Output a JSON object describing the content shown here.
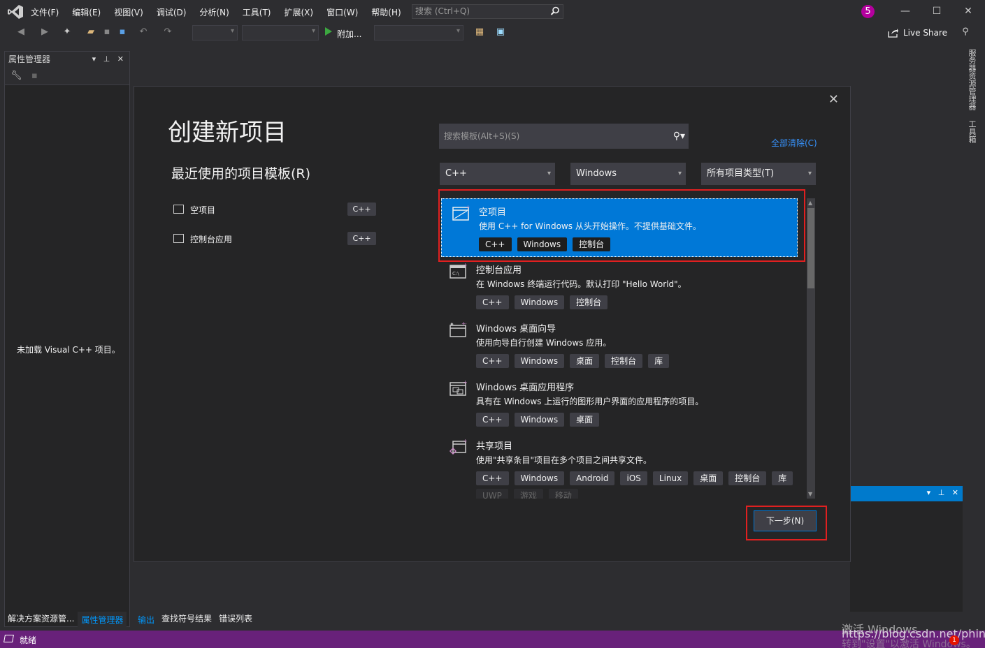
{
  "menu": [
    "文件(F)",
    "编辑(E)",
    "视图(V)",
    "调试(D)",
    "分析(N)",
    "工具(T)",
    "扩展(X)",
    "窗口(W)",
    "帮助(H)"
  ],
  "quick_search_placeholder": "搜索 (Ctrl+Q)",
  "notification_count": "5",
  "toolbar": {
    "run_label": "附加...",
    "live_share": "Live Share"
  },
  "left_panel": {
    "title": "属性管理器",
    "message": "未加载 Visual C++ 项目。",
    "tabs": [
      "解决方案资源管...",
      "属性管理器"
    ]
  },
  "bottom_tabs": [
    "输出",
    "查找符号结果",
    "错误列表"
  ],
  "right_tabs": [
    "服务器资源管理器",
    "工具箱"
  ],
  "status": {
    "text": "就绪"
  },
  "watermark": {
    "line1": "激活 Windows",
    "line2": "https://blog.csdn.net/phinoo",
    "line3": "转到\"设置\"以激活 Windows。"
  },
  "dialog": {
    "title": "创建新项目",
    "recent_heading": "最近使用的项目模板(R)",
    "recent": [
      {
        "label": "空项目",
        "tag": "C++"
      },
      {
        "label": "控制台应用",
        "tag": "C++"
      }
    ],
    "search_placeholder": "搜索模板(Alt+S)(S)",
    "clear_all": "全部清除(C)",
    "filters": [
      "C++",
      "Windows",
      "所有项目类型(T)"
    ],
    "templates": [
      {
        "name": "空项目",
        "desc": "使用 C++ for Windows 从头开始操作。不提供基础文件。",
        "tags": [
          "C++",
          "Windows",
          "控制台"
        ]
      },
      {
        "name": "控制台应用",
        "desc": "在 Windows 终端运行代码。默认打印 \"Hello World\"。",
        "tags": [
          "C++",
          "Windows",
          "控制台"
        ]
      },
      {
        "name": "Windows 桌面向导",
        "desc": "使用向导自行创建 Windows 应用。",
        "tags": [
          "C++",
          "Windows",
          "桌面",
          "控制台",
          "库"
        ]
      },
      {
        "name": "Windows 桌面应用程序",
        "desc": "具有在 Windows 上运行的图形用户界面的应用程序的项目。",
        "tags": [
          "C++",
          "Windows",
          "桌面"
        ]
      },
      {
        "name": "共享项目",
        "desc": "使用\"共享条目\"项目在多个项目之间共享文件。",
        "tags": [
          "C++",
          "Windows",
          "Android",
          "iOS",
          "Linux",
          "桌面",
          "控制台",
          "库"
        ],
        "tags2": [
          "UWP",
          "游戏",
          "移动"
        ]
      }
    ],
    "next_button": "下一步(N)"
  }
}
